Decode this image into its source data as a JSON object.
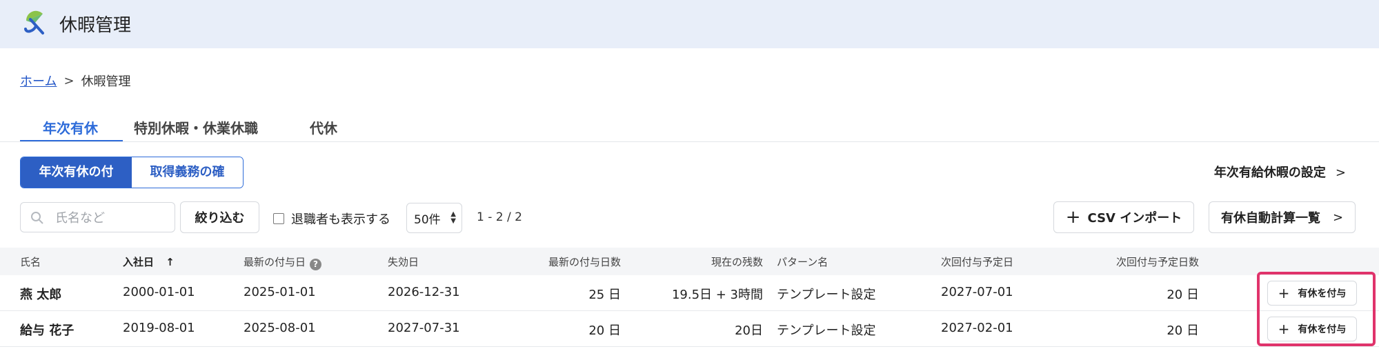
{
  "header": {
    "app_title": "休暇管理",
    "logo_icon": "umbrella-logo-icon"
  },
  "breadcrumb": {
    "home": "ホーム",
    "separator": ">",
    "current": "休暇管理"
  },
  "tabs": [
    {
      "label": "年次有休",
      "active": true
    },
    {
      "label": "特別休暇・休業休職",
      "active": false
    },
    {
      "label": "代休",
      "active": false
    }
  ],
  "segment": {
    "grant": "年次有休の付与",
    "check": "取得義務の確認"
  },
  "settings_link": {
    "label": "年次有給休暇の設定",
    "chevron": ">"
  },
  "toolbar": {
    "search_placeholder": "氏名など",
    "filter_label": "絞り込む",
    "show_retired_label": "退職者も表示する",
    "show_retired_checked": false,
    "page_size": "50件",
    "pager_text": "1 - 2 / 2",
    "csv_import_label": "CSV インポート",
    "auto_calc_label": "有休自動計算一覧"
  },
  "table": {
    "headers": {
      "name": "氏名",
      "join_date": "入社日",
      "sort_arrow": "↑",
      "last_grant_date": "最新の付与日",
      "help": "?",
      "expiry": "失効日",
      "last_grant_days": "最新の付与日数",
      "remaining": "現在の残数",
      "pattern": "パターン名",
      "next_grant_date": "次回付与予定日",
      "next_grant_days": "次回付与予定日数"
    },
    "rows": [
      {
        "name": "燕 太郎",
        "join_date": "2000-01-01",
        "last_grant_date": "2025-01-01",
        "expiry": "2026-12-31",
        "last_grant_days": "25 日",
        "remaining": "19.5日 + 3時間",
        "pattern": "テンプレート設定",
        "next_grant_date": "2027-07-01",
        "next_grant_days": "20 日",
        "action": "有休を付与"
      },
      {
        "name": "給与 花子",
        "join_date": "2019-08-01",
        "last_grant_date": "2025-08-01",
        "expiry": "2027-07-31",
        "last_grant_days": "20 日",
        "remaining": "20日",
        "pattern": "テンプレート設定",
        "next_grant_date": "2027-02-01",
        "next_grant_days": "20 日",
        "action": "有休を付与"
      }
    ]
  },
  "colors": {
    "accent": "#2d6bd9",
    "highlight": "#e0336b",
    "header_bg": "#e8eef9"
  }
}
